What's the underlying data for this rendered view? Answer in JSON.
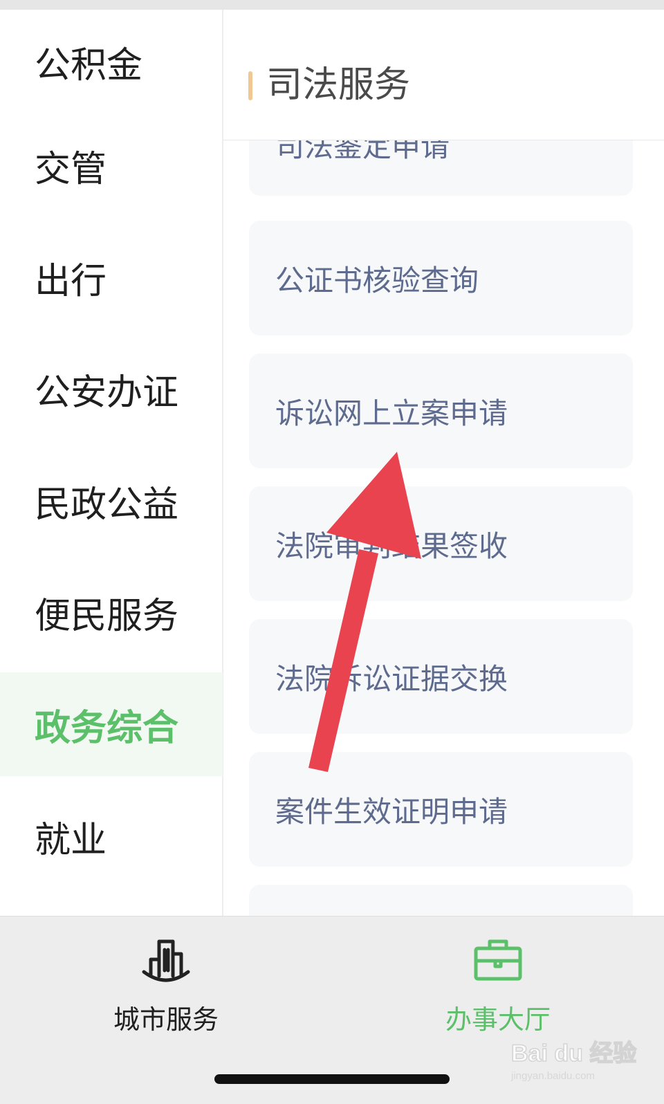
{
  "sidebar": {
    "items": [
      {
        "label": "公积金",
        "active": false
      },
      {
        "label": "交管",
        "active": false
      },
      {
        "label": "出行",
        "active": false
      },
      {
        "label": "公安办证",
        "active": false
      },
      {
        "label": "民政公益",
        "active": false
      },
      {
        "label": "便民服务",
        "active": false
      },
      {
        "label": "政务综合",
        "active": true
      },
      {
        "label": "就业",
        "active": false
      }
    ]
  },
  "content": {
    "section_title": "司法服务",
    "services": [
      {
        "label": "司法鉴定申请"
      },
      {
        "label": "公证书核验查询"
      },
      {
        "label": "诉讼网上立案申请"
      },
      {
        "label": "法院审判结果签收"
      },
      {
        "label": "法院诉讼证据交换"
      },
      {
        "label": "案件生效证明申请"
      },
      {
        "label": ""
      }
    ]
  },
  "tabbar": {
    "tabs": [
      {
        "label": "城市服务",
        "icon": "city-building-icon",
        "active": false
      },
      {
        "label": "办事大厅",
        "icon": "briefcase-icon",
        "active": true
      }
    ]
  },
  "watermark": {
    "brand": "Bai du 经验",
    "url": "jingyan.baidu.com"
  },
  "colors": {
    "accent_green": "#5cbf6a",
    "section_accent": "#f1c893",
    "card_text": "#5e6b8e",
    "arrow_red": "#e8434f"
  }
}
